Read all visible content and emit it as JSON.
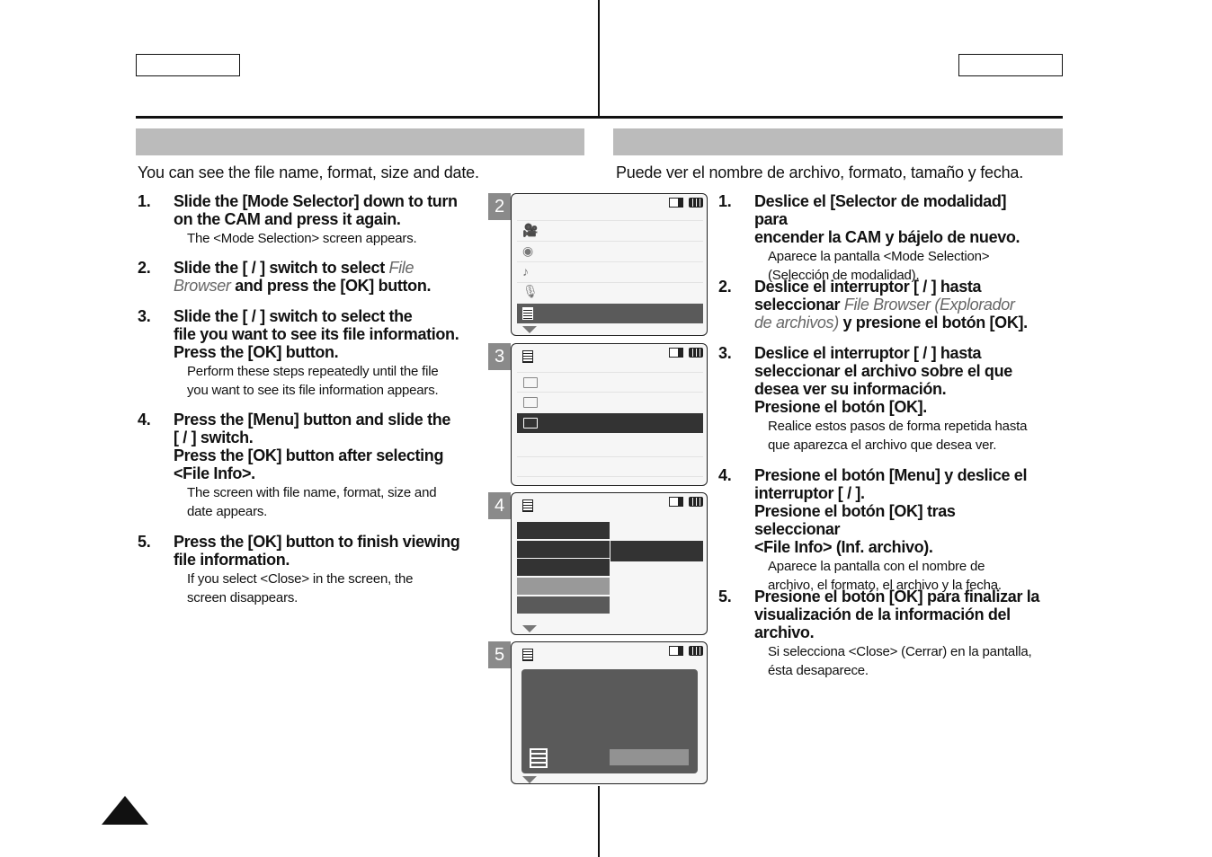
{
  "left": {
    "intro": "You can see the file name, format, size and date.",
    "steps": [
      {
        "num": "1.",
        "lines": [
          "Slide the [Mode Selector] down to turn",
          "on the CAM and press it again."
        ],
        "sub": [
          "The <Mode Selection> screen appears."
        ]
      },
      {
        "num": "2.",
        "l1": "Slide the [    /    ] switch to select ",
        "l1i": "File",
        "l2i": "Browser",
        "l2": " and press the [OK] button.",
        "sub": []
      },
      {
        "num": "3.",
        "lines": [
          "Slide the [    /    ] switch to select the",
          "file you want to see its file information.",
          "Press the [OK] button."
        ],
        "sub": [
          "Perform these steps repeatedly until the file",
          "you want to see its file information appears."
        ]
      },
      {
        "num": "4.",
        "lines": [
          "Press the [Menu] button and slide the",
          "[    /    ] switch.",
          "Press the [OK] button after selecting",
          "<File Info>."
        ],
        "sub": [
          "The screen with file name, format, size and",
          "date appears."
        ]
      },
      {
        "num": "5.",
        "lines": [
          "Press the [OK] button to finish viewing",
          "file information."
        ],
        "sub": [
          "If you select <Close> in the screen, the",
          "screen disappears."
        ]
      }
    ]
  },
  "right": {
    "intro": "Puede ver el nombre de archivo, formato, tamaño y fecha.",
    "steps": [
      {
        "num": "1.",
        "lines": [
          "Deslice el [Selector de modalidad] para",
          "encender la CAM y bájelo de nuevo."
        ],
        "sub": [
          "Aparece la pantalla <Mode Selection>",
          "(Selección de modalidad)."
        ]
      },
      {
        "num": "2.",
        "l1": "Deslice el interruptor [    /    ] hasta",
        "l2": "seleccionar ",
        "l2i": "File Browser (Explorador",
        "l3i": "de archivos)",
        "l3": " y presione el botón [OK].",
        "sub": []
      },
      {
        "num": "3.",
        "lines": [
          "Deslice el interruptor [    /    ] hasta",
          "seleccionar el archivo sobre el que",
          "desea ver su información.",
          "Presione el botón [OK]."
        ],
        "sub": [
          "Realice estos pasos de forma repetida hasta",
          "que aparezca el archivo que desea ver."
        ]
      },
      {
        "num": "4.",
        "lines": [
          "Presione el botón [Menu] y deslice el",
          "interruptor [    /    ].",
          "Presione el botón [OK] tras seleccionar",
          "<File Info> (Inf. archivo)."
        ],
        "sub": [
          "Aparece la pantalla con el nombre de",
          "archivo, el formato, el archivo y la fecha."
        ]
      },
      {
        "num": "5.",
        "lines": [
          "Presione el botón [OK] para finalizar la",
          "visualización de la información del",
          "archivo."
        ],
        "sub": [
          "Si selecciona <Close> (Cerrar) en la pantalla,",
          "ésta desaparece."
        ]
      }
    ]
  },
  "screens": [
    {
      "tab": "2"
    },
    {
      "tab": "3"
    },
    {
      "tab": "4"
    },
    {
      "tab": "5"
    }
  ],
  "colors": {
    "section_bar": "#bbbbbb",
    "highlight": "#5a5a5a",
    "dark": "#333333"
  }
}
